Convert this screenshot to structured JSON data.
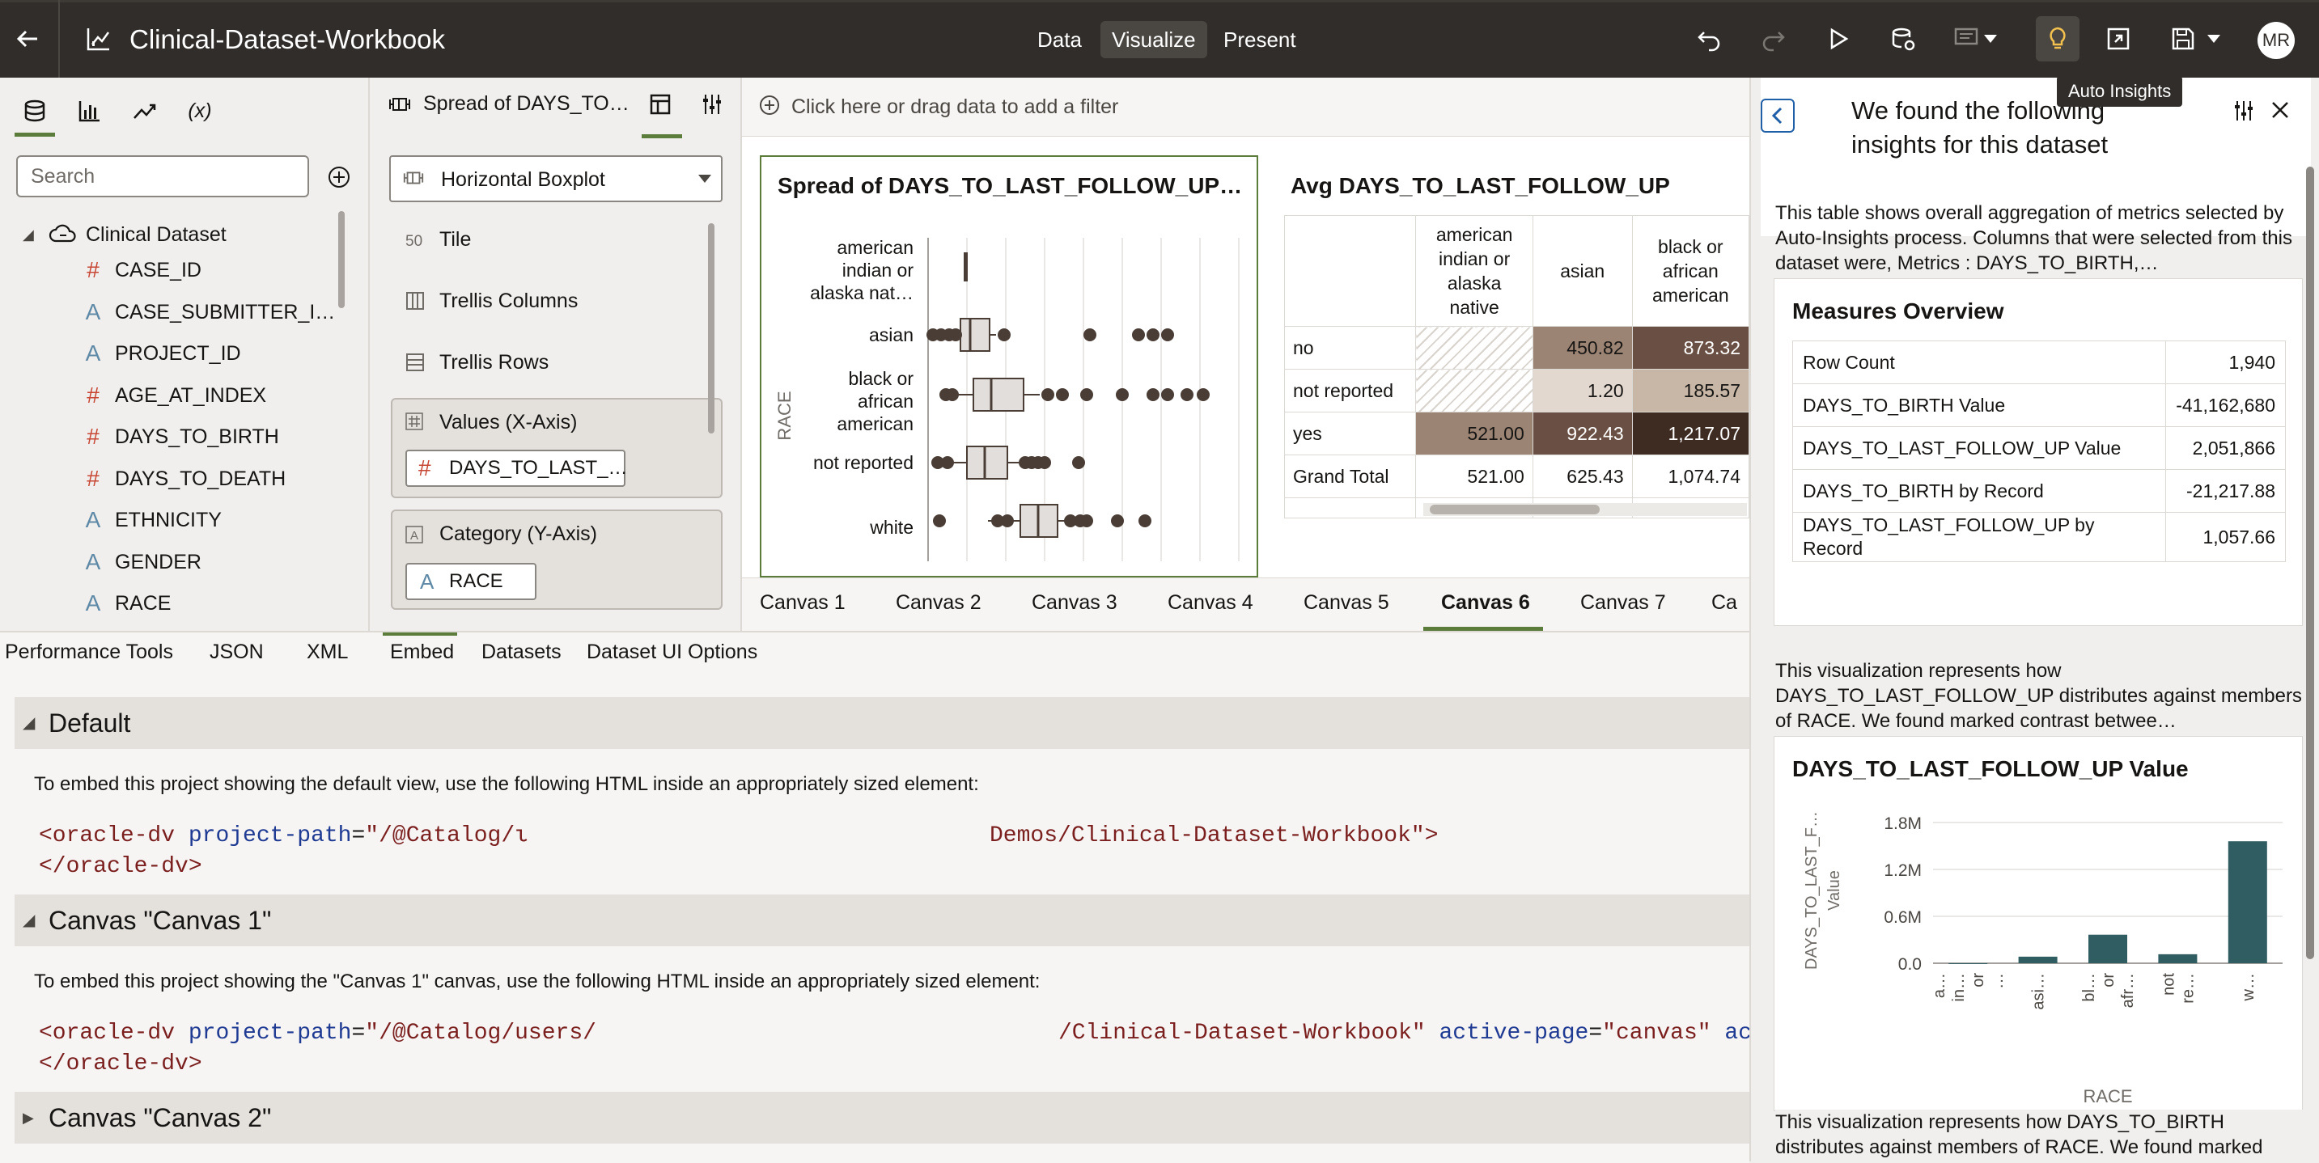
{
  "app": {
    "title": "Clinical-Dataset-Workbook",
    "modes": [
      "Data",
      "Visualize",
      "Present"
    ],
    "active_mode": "Visualize",
    "user_initials": "MR",
    "tooltip": "Auto Insights"
  },
  "data_panel": {
    "search_placeholder": "Search",
    "dataset_name": "Clinical Dataset",
    "columns": [
      {
        "name": "CASE_ID",
        "type": "number"
      },
      {
        "name": "CASE_SUBMITTER_I…",
        "type": "attribute"
      },
      {
        "name": "PROJECT_ID",
        "type": "attribute"
      },
      {
        "name": "AGE_AT_INDEX",
        "type": "number"
      },
      {
        "name": "DAYS_TO_BIRTH",
        "type": "number"
      },
      {
        "name": "DAYS_TO_DEATH",
        "type": "number"
      },
      {
        "name": "ETHNICITY",
        "type": "attribute"
      },
      {
        "name": "GENDER",
        "type": "attribute"
      },
      {
        "name": "RACE",
        "type": "attribute"
      }
    ],
    "tab_icons": [
      "database-icon",
      "bar-chart-icon",
      "trend-icon",
      "variable-icon"
    ],
    "variable_tab_label": "(x)"
  },
  "grammar": {
    "viz_name": "Spread of DAYS_TO…",
    "viz_type": "Horizontal Boxplot",
    "rows": [
      "Tile",
      "Trellis Columns",
      "Trellis Rows"
    ],
    "tile_icon_text": "50",
    "values_label": "Values (X-Axis)",
    "values_pill": "DAYS_TO_LAST_…",
    "category_label": "Category (Y-Axis)",
    "category_pill": "RACE"
  },
  "canvas": {
    "filter_placeholder": "Click here or drag data to add a filter",
    "boxplot": {
      "title": "Spread of DAYS_TO_LAST_FOLLOW_UP…",
      "axis_label": "RACE",
      "categories": [
        [
          "american",
          "indian or",
          "alaska nat…"
        ],
        [
          "asian"
        ],
        [
          "black or",
          "african",
          "american"
        ],
        [
          "not reported"
        ],
        [
          "white"
        ]
      ]
    },
    "pivot": {
      "title": "Avg DAYS_TO_LAST_FOLLOW_UP",
      "col_headers": [
        [
          "american",
          "indian or",
          "alaska",
          "native"
        ],
        [
          "asian"
        ],
        [
          "black or",
          "african",
          "american"
        ]
      ],
      "rows": [
        {
          "label": "no",
          "values": [
            "",
            "450.82",
            "873.32"
          ]
        },
        {
          "label": "not reported",
          "values": [
            "",
            "1.20",
            "185.57"
          ]
        },
        {
          "label": "yes",
          "values": [
            "521.00",
            "922.43",
            "1,217.07"
          ]
        },
        {
          "label": "Grand Total",
          "values": [
            "521.00",
            "625.43",
            "1,074.74"
          ]
        }
      ]
    },
    "tabs": [
      "Canvas 1",
      "Canvas 2",
      "Canvas 3",
      "Canvas 4",
      "Canvas 5",
      "Canvas 6",
      "Canvas 7",
      "Ca"
    ],
    "active_tab": "Canvas 6"
  },
  "dev_console": {
    "tabs": [
      "Performance Tools",
      "JSON",
      "XML",
      "Embed",
      "Datasets",
      "Dataset UI Options"
    ],
    "active_tab": "Embed",
    "sections": [
      {
        "title": "Default",
        "description": "To embed this project showing the default view, use the following HTML inside an appropriately sized element:",
        "code_open_tag": "<oracle-dv",
        "code_attr": "project-path",
        "code_eq": "=",
        "code_value_start": "\"/@Catalog/ι",
        "code_value_end": "Demos/Clinical-Dataset-Workbook\">",
        "code_close": "</oracle-dv>"
      },
      {
        "title": "Canvas \"Canvas 1\"",
        "description": "To embed this project showing the \"Canvas 1\" canvas, use the following HTML inside an appropriately sized element:",
        "code_open_tag": "<oracle-dv",
        "code_attr": "project-path",
        "code_eq": "=",
        "code_value_start": "\"/@Catalog/users/",
        "code_value_end": "/Clinical-Dataset-Workbook\"",
        "code_attr2": "active-page",
        "code_value2": "\"canvas\"",
        "code_attr3": "ac",
        "code_close": "</oracle-dv>"
      },
      {
        "title": "Canvas \"Canvas 2\""
      }
    ]
  },
  "insights": {
    "title": "We found the following insights for this dataset",
    "intro": "This table shows overall aggregation of metrics selected by Auto-Insights process. Columns that were selected from this dataset were, Metrics : DAYS_TO_BIRTH,…",
    "measures_title": "Measures Overview",
    "measures": [
      {
        "label": "Row Count",
        "value": "1,940"
      },
      {
        "label": "DAYS_TO_BIRTH Value",
        "value": "-41,162,680"
      },
      {
        "label": "DAYS_TO_LAST_FOLLOW_UP Value",
        "value": "2,051,866"
      },
      {
        "label": "DAYS_TO_BIRTH by Record",
        "value": "-21,217.88"
      },
      {
        "label": "DAYS_TO_LAST_FOLLOW_UP by Record",
        "value": "1,057.66"
      }
    ],
    "viz_text_1": "This visualization represents how DAYS_TO_LAST_FOLLOW_UP distributes against members of RACE. We found marked contrast betwee…",
    "viz_text_2": "This visualization represents how DAYS_TO_BIRTH distributes against members of RACE. We found marked"
  },
  "chart_data": {
    "type": "bar",
    "title": "DAYS_TO_LAST_FOLLOW_UP Value",
    "xlabel": "RACE",
    "ylabel": "DAYS_TO_LAST_F… Value",
    "categories": [
      "a… in… or …",
      "asi…",
      "bl… or afr…",
      "not re…",
      "w…"
    ],
    "values": [
      520,
      84000,
      365000,
      115000,
      1560000
    ],
    "ylim": [
      0,
      1800000
    ],
    "y_ticks": [
      "0.0",
      "0.6M",
      "1.2M",
      "1.8M"
    ],
    "y_tick_values": [
      0,
      600000,
      1200000,
      1800000
    ],
    "bar_color": "#2f5d62",
    "grid": true
  },
  "colors": {
    "topbar": "#312d2a",
    "accent": "#5b7c3b",
    "boxplot_dot": "#4a3d36",
    "heat": [
      "#ffffff",
      "#e2d8cf",
      "#c8b7a6",
      "#9c8474",
      "#6a5044",
      "#3e2b22"
    ]
  }
}
